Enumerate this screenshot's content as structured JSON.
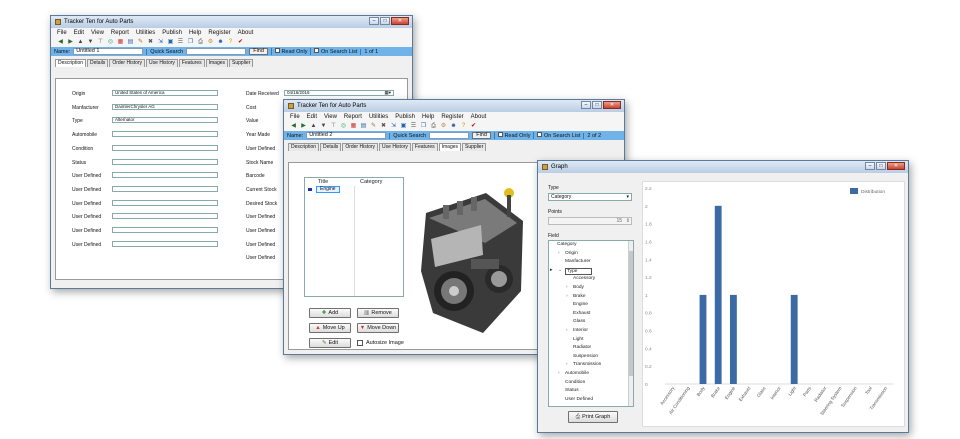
{
  "window1": {
    "title": "Tracker Ten for Auto Parts",
    "menu": [
      "File",
      "Edit",
      "View",
      "Report",
      "Utilities",
      "Publish",
      "Help",
      "Register",
      "About"
    ],
    "search": {
      "name_label": "Name:",
      "name_value": "Untitled 1",
      "quick_search": "Quick Search",
      "find": "Find",
      "read_only": "Read Only",
      "on_search_list": "On Search List",
      "record": "1 of 1"
    },
    "tabs": [
      "Description",
      "Details",
      "Order History",
      "Use History",
      "Features",
      "Images",
      "Supplier"
    ],
    "left_fields": [
      {
        "label": "Origin",
        "value": "United States of America"
      },
      {
        "label": "Manfacturer",
        "value": "DaimlerChrysler AG"
      },
      {
        "label": "Type",
        "value": "Alternator"
      },
      {
        "label": "Automobile",
        "value": ""
      },
      {
        "label": "Condition",
        "value": ""
      },
      {
        "label": "Status",
        "value": ""
      },
      {
        "label": "User Defined",
        "value": ""
      },
      {
        "label": "User Defined",
        "value": ""
      },
      {
        "label": "User Defined",
        "value": ""
      },
      {
        "label": "User Defined",
        "value": ""
      },
      {
        "label": "User Defined",
        "value": ""
      },
      {
        "label": "User Defined",
        "value": ""
      }
    ],
    "right_fields": [
      "Date Received",
      "Cost",
      "Value",
      "Year Made",
      "User Defined",
      "Stock Name",
      "Barcode",
      "Current Stock",
      "Desired Stock",
      "User Defined",
      "User Defined",
      "User Defined",
      "User Defined"
    ],
    "date_value": "04/16/2016"
  },
  "window2": {
    "title": "Tracker Ten for Auto Parts",
    "menu": [
      "File",
      "Edit",
      "View",
      "Report",
      "Utilities",
      "Publish",
      "Help",
      "Register",
      "About"
    ],
    "search": {
      "name_label": "Name:",
      "name_value": "Untitled 2",
      "quick_search": "Quick Search",
      "find": "Find",
      "read_only": "Read Only",
      "on_search_list": "On Search List",
      "record": "2 of 2"
    },
    "tabs": [
      "Description",
      "Details",
      "Order History",
      "Use History",
      "Features",
      "Images",
      "Supplier"
    ],
    "list_headers": [
      "Title",
      "Category"
    ],
    "list_rows": [
      {
        "title": "Engine",
        "category": ""
      }
    ],
    "buttons": {
      "add": "Add",
      "remove": "Remove",
      "move_up": "Move Up",
      "move_down": "Move Down",
      "edit": "Edit",
      "autosize": "Autosize Image"
    }
  },
  "window3": {
    "title": "Graph",
    "type_label": "Type",
    "type_value": "Category",
    "points_label": "Points",
    "points_value": "15",
    "field_label": "Field",
    "tree": [
      {
        "label": "Category",
        "level": 0,
        "exp": ""
      },
      {
        "label": "Origin",
        "level": 1,
        "exp": "›"
      },
      {
        "label": "Manfacturer",
        "level": 1,
        "exp": ""
      },
      {
        "label": "Type",
        "level": 1,
        "exp": "⌄"
      },
      {
        "label": "Accessory",
        "level": 2,
        "exp": ""
      },
      {
        "label": "Body",
        "level": 2,
        "exp": "›"
      },
      {
        "label": "Brake",
        "level": 2,
        "exp": "›"
      },
      {
        "label": "Engine",
        "level": 2,
        "exp": ""
      },
      {
        "label": "Exhaust",
        "level": 2,
        "exp": ""
      },
      {
        "label": "Glass",
        "level": 2,
        "exp": ""
      },
      {
        "label": "Interior",
        "level": 2,
        "exp": "›"
      },
      {
        "label": "Light",
        "level": 2,
        "exp": ""
      },
      {
        "label": "Radiator",
        "level": 2,
        "exp": ""
      },
      {
        "label": "Suspension",
        "level": 2,
        "exp": ""
      },
      {
        "label": "Transmission",
        "level": 2,
        "exp": "›"
      },
      {
        "label": "Automobile",
        "level": 1,
        "exp": "›"
      },
      {
        "label": "Condition",
        "level": 1,
        "exp": ""
      },
      {
        "label": "Status",
        "level": 1,
        "exp": ""
      },
      {
        "label": "User Defined",
        "level": 1,
        "exp": ""
      }
    ],
    "print_button": "Print Graph"
  },
  "chart_data": {
    "type": "bar",
    "categories": [
      "Accessory",
      "Air Conditioning",
      "Body",
      "Brake",
      "Engine",
      "Exhaust",
      "Glass",
      "Interior",
      "Light",
      "Parts",
      "Radiator",
      "Steering System",
      "Suspension",
      "Tool",
      "Transmission"
    ],
    "series": [
      {
        "name": "Distribution",
        "values": [
          0,
          0,
          1,
          2,
          1,
          0,
          0,
          0,
          1,
          0,
          0,
          0,
          0,
          0,
          0
        ],
        "color": "#3c6aa4"
      }
    ],
    "ylim": [
      0,
      2.2
    ],
    "yticks": [
      "0",
      "0.2",
      "0.4",
      "0.6",
      "0.8",
      "1",
      "1.2",
      "1.4",
      "1.6",
      "1.8",
      "2",
      "2.2"
    ],
    "legend_position": "top-right"
  }
}
